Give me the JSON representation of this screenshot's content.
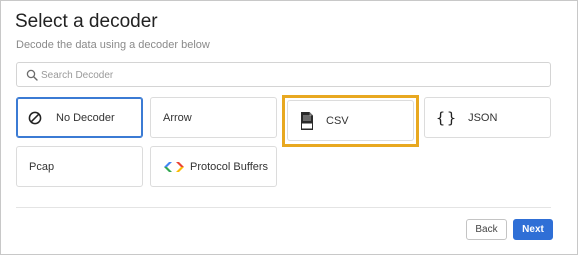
{
  "dialog": {
    "title": "Select a decoder",
    "subtitle": "Decode the data using a decoder below"
  },
  "search": {
    "placeholder": "Search Decoder",
    "value": "",
    "icon": "search-icon"
  },
  "decoders": [
    {
      "label": "No Decoder",
      "icon": "no-decoder-icon",
      "selected": true
    },
    {
      "label": "Arrow",
      "icon": "",
      "selected": false
    },
    {
      "label": "CSV",
      "icon": "csv-file-icon",
      "selected": false,
      "highlighted": true
    },
    {
      "label": "JSON",
      "icon": "json-braces-icon",
      "selected": false
    },
    {
      "label": "Pcap",
      "icon": "",
      "selected": false
    },
    {
      "label": "Protocol Buffers",
      "icon": "protocol-buffers-icon",
      "selected": false
    }
  ],
  "actions": {
    "back_label": "Back",
    "next_label": "Next"
  },
  "colors": {
    "accent": "#2f6fd6",
    "highlight": "#e8a820",
    "selected_border": "#3b7bd4"
  }
}
